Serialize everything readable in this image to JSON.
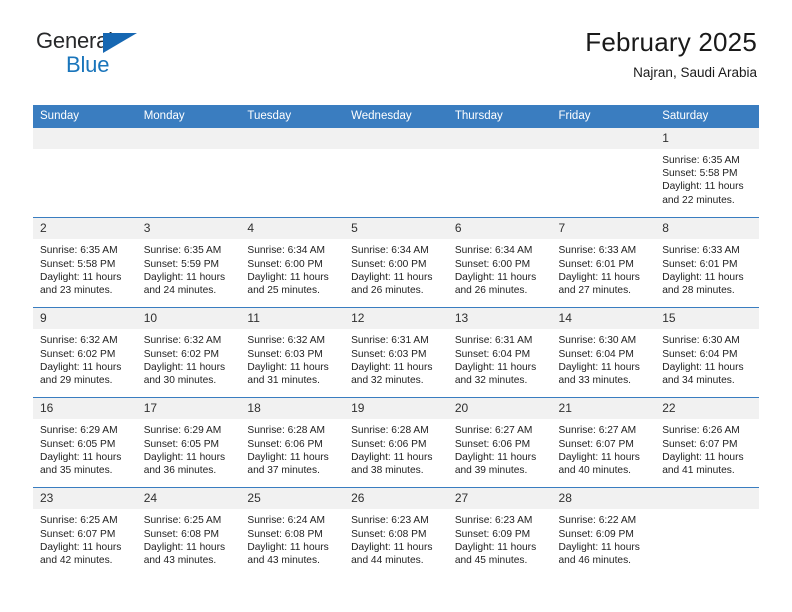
{
  "brand": {
    "name_part1": "General",
    "name_part2": "Blue",
    "triangle_icon": "blue-triangle-logo-mark",
    "color_dark": "#27282a",
    "color_blue": "#1a75bb"
  },
  "header": {
    "title": "February 2025",
    "subtitle": "Najran, Saudi Arabia"
  },
  "theme": {
    "header_row_bg": "#3a7dc0",
    "daynum_bg": "#f1f1f1",
    "divider": "#3a7dc0",
    "page_bg": "#ffffff"
  },
  "weekday_headers": [
    "Sunday",
    "Monday",
    "Tuesday",
    "Wednesday",
    "Thursday",
    "Friday",
    "Saturday"
  ],
  "labels": {
    "sunrise": "Sunrise:",
    "sunset": "Sunset:",
    "daylight": "Daylight:"
  },
  "weeks": [
    [
      {
        "day": "",
        "blank": true,
        "sunrise": "",
        "sunset": "",
        "daylight_line1": "",
        "daylight_line2": ""
      },
      {
        "day": "",
        "blank": true,
        "sunrise": "",
        "sunset": "",
        "daylight_line1": "",
        "daylight_line2": ""
      },
      {
        "day": "",
        "blank": true,
        "sunrise": "",
        "sunset": "",
        "daylight_line1": "",
        "daylight_line2": ""
      },
      {
        "day": "",
        "blank": true,
        "sunrise": "",
        "sunset": "",
        "daylight_line1": "",
        "daylight_line2": ""
      },
      {
        "day": "",
        "blank": true,
        "sunrise": "",
        "sunset": "",
        "daylight_line1": "",
        "daylight_line2": ""
      },
      {
        "day": "",
        "blank": true,
        "sunrise": "",
        "sunset": "",
        "daylight_line1": "",
        "daylight_line2": ""
      },
      {
        "day": "1",
        "blank": false,
        "sunrise": "Sunrise: 6:35 AM",
        "sunset": "Sunset: 5:58 PM",
        "daylight_line1": "Daylight: 11 hours",
        "daylight_line2": "and 22 minutes."
      }
    ],
    [
      {
        "day": "2",
        "blank": false,
        "sunrise": "Sunrise: 6:35 AM",
        "sunset": "Sunset: 5:58 PM",
        "daylight_line1": "Daylight: 11 hours",
        "daylight_line2": "and 23 minutes."
      },
      {
        "day": "3",
        "blank": false,
        "sunrise": "Sunrise: 6:35 AM",
        "sunset": "Sunset: 5:59 PM",
        "daylight_line1": "Daylight: 11 hours",
        "daylight_line2": "and 24 minutes."
      },
      {
        "day": "4",
        "blank": false,
        "sunrise": "Sunrise: 6:34 AM",
        "sunset": "Sunset: 6:00 PM",
        "daylight_line1": "Daylight: 11 hours",
        "daylight_line2": "and 25 minutes."
      },
      {
        "day": "5",
        "blank": false,
        "sunrise": "Sunrise: 6:34 AM",
        "sunset": "Sunset: 6:00 PM",
        "daylight_line1": "Daylight: 11 hours",
        "daylight_line2": "and 26 minutes."
      },
      {
        "day": "6",
        "blank": false,
        "sunrise": "Sunrise: 6:34 AM",
        "sunset": "Sunset: 6:00 PM",
        "daylight_line1": "Daylight: 11 hours",
        "daylight_line2": "and 26 minutes."
      },
      {
        "day": "7",
        "blank": false,
        "sunrise": "Sunrise: 6:33 AM",
        "sunset": "Sunset: 6:01 PM",
        "daylight_line1": "Daylight: 11 hours",
        "daylight_line2": "and 27 minutes."
      },
      {
        "day": "8",
        "blank": false,
        "sunrise": "Sunrise: 6:33 AM",
        "sunset": "Sunset: 6:01 PM",
        "daylight_line1": "Daylight: 11 hours",
        "daylight_line2": "and 28 minutes."
      }
    ],
    [
      {
        "day": "9",
        "blank": false,
        "sunrise": "Sunrise: 6:32 AM",
        "sunset": "Sunset: 6:02 PM",
        "daylight_line1": "Daylight: 11 hours",
        "daylight_line2": "and 29 minutes."
      },
      {
        "day": "10",
        "blank": false,
        "sunrise": "Sunrise: 6:32 AM",
        "sunset": "Sunset: 6:02 PM",
        "daylight_line1": "Daylight: 11 hours",
        "daylight_line2": "and 30 minutes."
      },
      {
        "day": "11",
        "blank": false,
        "sunrise": "Sunrise: 6:32 AM",
        "sunset": "Sunset: 6:03 PM",
        "daylight_line1": "Daylight: 11 hours",
        "daylight_line2": "and 31 minutes."
      },
      {
        "day": "12",
        "blank": false,
        "sunrise": "Sunrise: 6:31 AM",
        "sunset": "Sunset: 6:03 PM",
        "daylight_line1": "Daylight: 11 hours",
        "daylight_line2": "and 32 minutes."
      },
      {
        "day": "13",
        "blank": false,
        "sunrise": "Sunrise: 6:31 AM",
        "sunset": "Sunset: 6:04 PM",
        "daylight_line1": "Daylight: 11 hours",
        "daylight_line2": "and 32 minutes."
      },
      {
        "day": "14",
        "blank": false,
        "sunrise": "Sunrise: 6:30 AM",
        "sunset": "Sunset: 6:04 PM",
        "daylight_line1": "Daylight: 11 hours",
        "daylight_line2": "and 33 minutes."
      },
      {
        "day": "15",
        "blank": false,
        "sunrise": "Sunrise: 6:30 AM",
        "sunset": "Sunset: 6:04 PM",
        "daylight_line1": "Daylight: 11 hours",
        "daylight_line2": "and 34 minutes."
      }
    ],
    [
      {
        "day": "16",
        "blank": false,
        "sunrise": "Sunrise: 6:29 AM",
        "sunset": "Sunset: 6:05 PM",
        "daylight_line1": "Daylight: 11 hours",
        "daylight_line2": "and 35 minutes."
      },
      {
        "day": "17",
        "blank": false,
        "sunrise": "Sunrise: 6:29 AM",
        "sunset": "Sunset: 6:05 PM",
        "daylight_line1": "Daylight: 11 hours",
        "daylight_line2": "and 36 minutes."
      },
      {
        "day": "18",
        "blank": false,
        "sunrise": "Sunrise: 6:28 AM",
        "sunset": "Sunset: 6:06 PM",
        "daylight_line1": "Daylight: 11 hours",
        "daylight_line2": "and 37 minutes."
      },
      {
        "day": "19",
        "blank": false,
        "sunrise": "Sunrise: 6:28 AM",
        "sunset": "Sunset: 6:06 PM",
        "daylight_line1": "Daylight: 11 hours",
        "daylight_line2": "and 38 minutes."
      },
      {
        "day": "20",
        "blank": false,
        "sunrise": "Sunrise: 6:27 AM",
        "sunset": "Sunset: 6:06 PM",
        "daylight_line1": "Daylight: 11 hours",
        "daylight_line2": "and 39 minutes."
      },
      {
        "day": "21",
        "blank": false,
        "sunrise": "Sunrise: 6:27 AM",
        "sunset": "Sunset: 6:07 PM",
        "daylight_line1": "Daylight: 11 hours",
        "daylight_line2": "and 40 minutes."
      },
      {
        "day": "22",
        "blank": false,
        "sunrise": "Sunrise: 6:26 AM",
        "sunset": "Sunset: 6:07 PM",
        "daylight_line1": "Daylight: 11 hours",
        "daylight_line2": "and 41 minutes."
      }
    ],
    [
      {
        "day": "23",
        "blank": false,
        "sunrise": "Sunrise: 6:25 AM",
        "sunset": "Sunset: 6:07 PM",
        "daylight_line1": "Daylight: 11 hours",
        "daylight_line2": "and 42 minutes."
      },
      {
        "day": "24",
        "blank": false,
        "sunrise": "Sunrise: 6:25 AM",
        "sunset": "Sunset: 6:08 PM",
        "daylight_line1": "Daylight: 11 hours",
        "daylight_line2": "and 43 minutes."
      },
      {
        "day": "25",
        "blank": false,
        "sunrise": "Sunrise: 6:24 AM",
        "sunset": "Sunset: 6:08 PM",
        "daylight_line1": "Daylight: 11 hours",
        "daylight_line2": "and 43 minutes."
      },
      {
        "day": "26",
        "blank": false,
        "sunrise": "Sunrise: 6:23 AM",
        "sunset": "Sunset: 6:08 PM",
        "daylight_line1": "Daylight: 11 hours",
        "daylight_line2": "and 44 minutes."
      },
      {
        "day": "27",
        "blank": false,
        "sunrise": "Sunrise: 6:23 AM",
        "sunset": "Sunset: 6:09 PM",
        "daylight_line1": "Daylight: 11 hours",
        "daylight_line2": "and 45 minutes."
      },
      {
        "day": "28",
        "blank": false,
        "sunrise": "Sunrise: 6:22 AM",
        "sunset": "Sunset: 6:09 PM",
        "daylight_line1": "Daylight: 11 hours",
        "daylight_line2": "and 46 minutes."
      },
      {
        "day": "",
        "blank": true,
        "sunrise": "",
        "sunset": "",
        "daylight_line1": "",
        "daylight_line2": ""
      }
    ]
  ]
}
